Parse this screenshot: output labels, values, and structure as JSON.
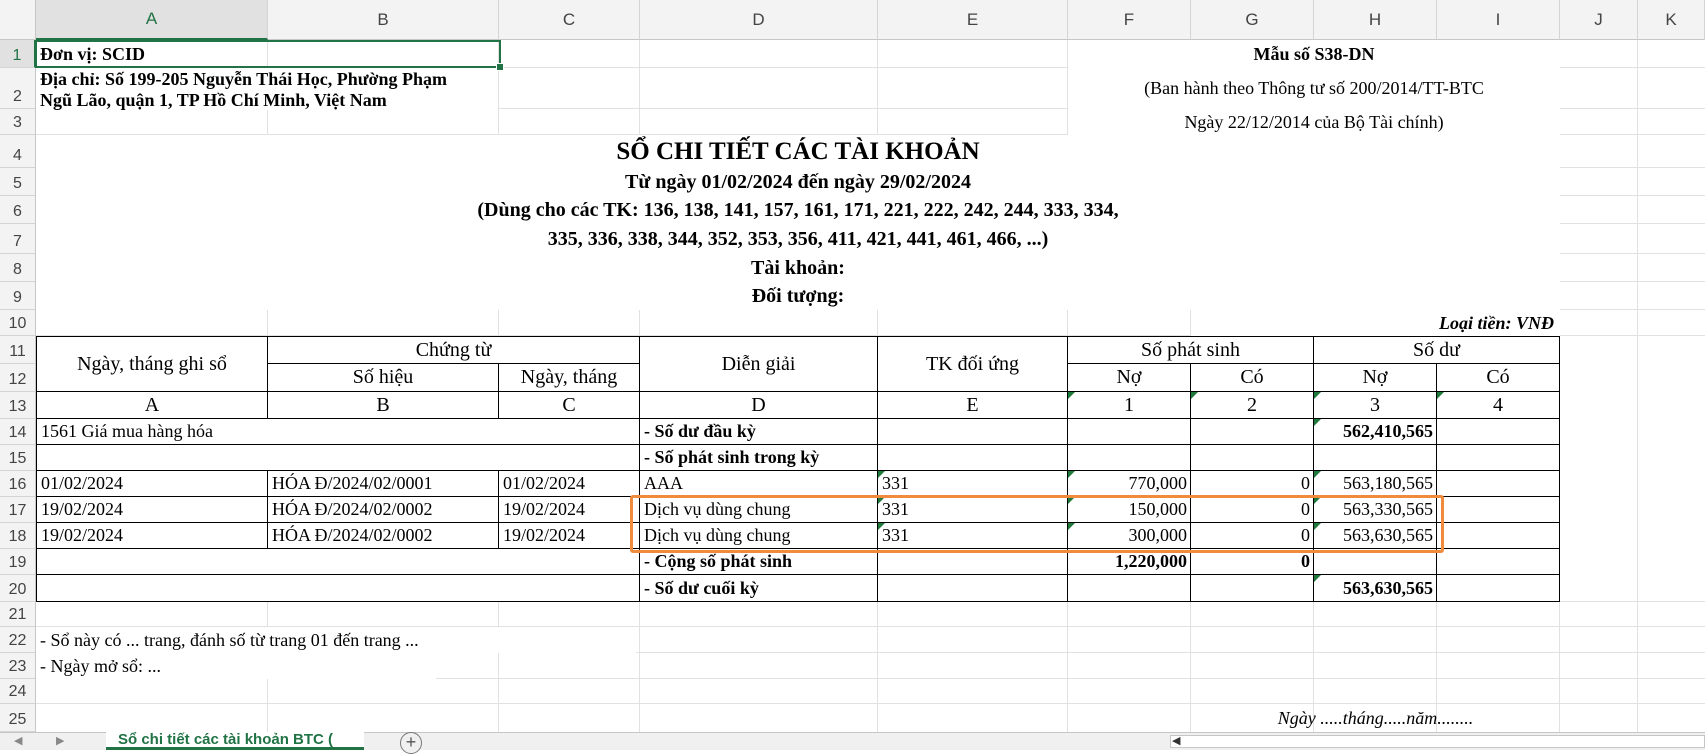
{
  "columns": [
    "A",
    "B",
    "C",
    "D",
    "E",
    "F",
    "G",
    "H",
    "I",
    "J",
    "K"
  ],
  "rows": [
    "1",
    "2",
    "3",
    "4",
    "5",
    "6",
    "7",
    "8",
    "9",
    "10",
    "11",
    "12",
    "13",
    "14",
    "15",
    "16",
    "17",
    "18",
    "19",
    "20",
    "21",
    "22",
    "23",
    "24",
    "25"
  ],
  "header": {
    "don_vi": "Đơn vị: SCID",
    "dia_chi_1": "Địa chỉ: Số 199-205 Nguyễn Thái Học, Phường Phạm",
    "dia_chi_2": "Ngũ Lão, quận 1, TP Hồ Chí Minh, Việt Nam",
    "mau_so": "Mẫu số S38-DN",
    "ban_hanh": "(Ban hành theo Thông tư số 200/2014/TT-BTC",
    "ngay_ban_hanh": "Ngày 22/12/2014 của Bộ Tài chính)"
  },
  "title": {
    "main": "SỔ CHI TIẾT CÁC TÀI KHOẢN",
    "period": "Từ ngày 01/02/2024 đến ngày 29/02/2024",
    "accounts_1": "(Dùng cho các TK: 136, 138, 141, 157, 161, 171, 221, 222, 242, 244, 333, 334,",
    "accounts_2": "335, 336, 338, 344, 352, 353, 356,  411, 421, 441,  461, 466, ...)",
    "tai_khoan": "Tài khoản:",
    "doi_tuong": "Đối tượng:",
    "loai_tien": "Loại tiền: VNĐ"
  },
  "table_header": {
    "ngay_ghi_so": "Ngày, tháng ghi sổ",
    "chung_tu": "Chứng từ",
    "so_hieu": "Số hiệu",
    "ngay_thang": "Ngày, tháng",
    "dien_giai": "Diễn giải",
    "tk_doi_ung": "TK đối ứng",
    "so_phat_sinh": "Số phát sinh",
    "so_du": "Số dư",
    "no_1": "Nợ",
    "co_1": "Có",
    "no_2": "Nợ",
    "co_2": "Có",
    "code_a": "A",
    "code_b": "B",
    "code_c": "C",
    "code_d": "D",
    "code_e": "E",
    "code_1": "1",
    "code_2": "2",
    "code_3": "3",
    "code_4": "4"
  },
  "table": {
    "account_name": "1561 Giá mua hàng hóa",
    "so_du_dau_ky_label": "- Số dư đầu kỳ",
    "so_du_dau_ky_value": "562,410,565",
    "so_phat_sinh_label": "- Số phát sinh trong kỳ",
    "entries": [
      {
        "ngay_ghi_so": "01/02/2024",
        "so_hieu": "HÓA Đ/2024/02/0001",
        "ngay_thang": "01/02/2024",
        "dien_giai": "AAA",
        "tk_doi_ung": "331",
        "no": "770,000",
        "co": "0",
        "du_no": "563,180,565"
      },
      {
        "ngay_ghi_so": "19/02/2024",
        "so_hieu": "HÓA Đ/2024/02/0002",
        "ngay_thang": "19/02/2024",
        "dien_giai": "Dịch vụ dùng chung",
        "tk_doi_ung": "331",
        "no": "150,000",
        "co": "0",
        "du_no": "563,330,565"
      },
      {
        "ngay_ghi_so": "19/02/2024",
        "so_hieu": "HÓA Đ/2024/02/0002",
        "ngay_thang": "19/02/2024",
        "dien_giai": "Dịch vụ dùng chung",
        "tk_doi_ung": "331",
        "no": "300,000",
        "co": "0",
        "du_no": "563,630,565"
      }
    ],
    "cong_label": "- Cộng số phát sinh",
    "cong_no": "1,220,000",
    "cong_co": "0",
    "so_du_cuoi_ky_label": "- Số dư cuối kỳ",
    "so_du_cuoi_ky_value": "563,630,565"
  },
  "footer": {
    "note_1": "- Sổ này có ... trang, đánh số từ trang 01 đến trang ...",
    "note_2": "- Ngày mở sổ: ...",
    "date_line": "Ngày .....tháng.....năm........"
  },
  "sheet_tabs": {
    "active": "Sổ chi tiết các tài khoản BTC (",
    "add": "+"
  },
  "colors": {
    "excel_green": "#217346",
    "highlight_orange": "#f08a3c"
  }
}
